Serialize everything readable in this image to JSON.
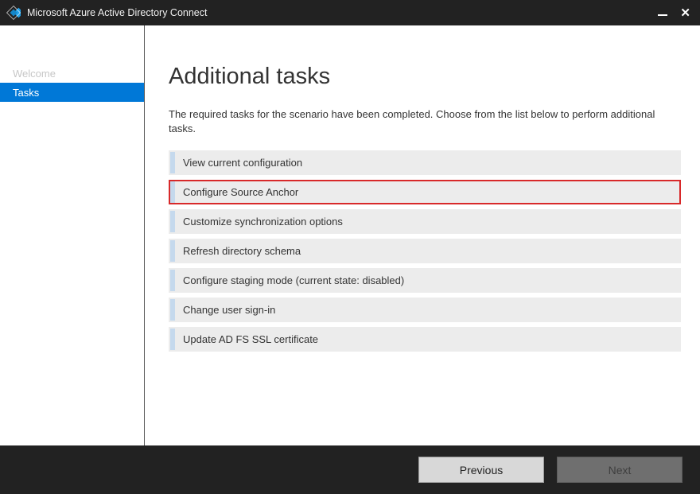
{
  "titlebar": {
    "title": "Microsoft Azure Active Directory Connect"
  },
  "sidebar": {
    "items": [
      {
        "label": "Welcome",
        "active": false
      },
      {
        "label": "Tasks",
        "active": true
      }
    ]
  },
  "main": {
    "heading": "Additional tasks",
    "description": "The required tasks for the scenario have been completed. Choose from the list below to perform additional tasks.",
    "tasks": [
      {
        "label": "View current configuration",
        "highlighted": false
      },
      {
        "label": "Configure Source Anchor",
        "highlighted": true
      },
      {
        "label": "Customize synchronization options",
        "highlighted": false
      },
      {
        "label": "Refresh directory schema",
        "highlighted": false
      },
      {
        "label": "Configure staging mode (current state: disabled)",
        "highlighted": false
      },
      {
        "label": "Change user sign-in",
        "highlighted": false
      },
      {
        "label": "Update AD FS SSL certificate",
        "highlighted": false
      }
    ]
  },
  "buttons": {
    "previous": "Previous",
    "next": "Next"
  }
}
